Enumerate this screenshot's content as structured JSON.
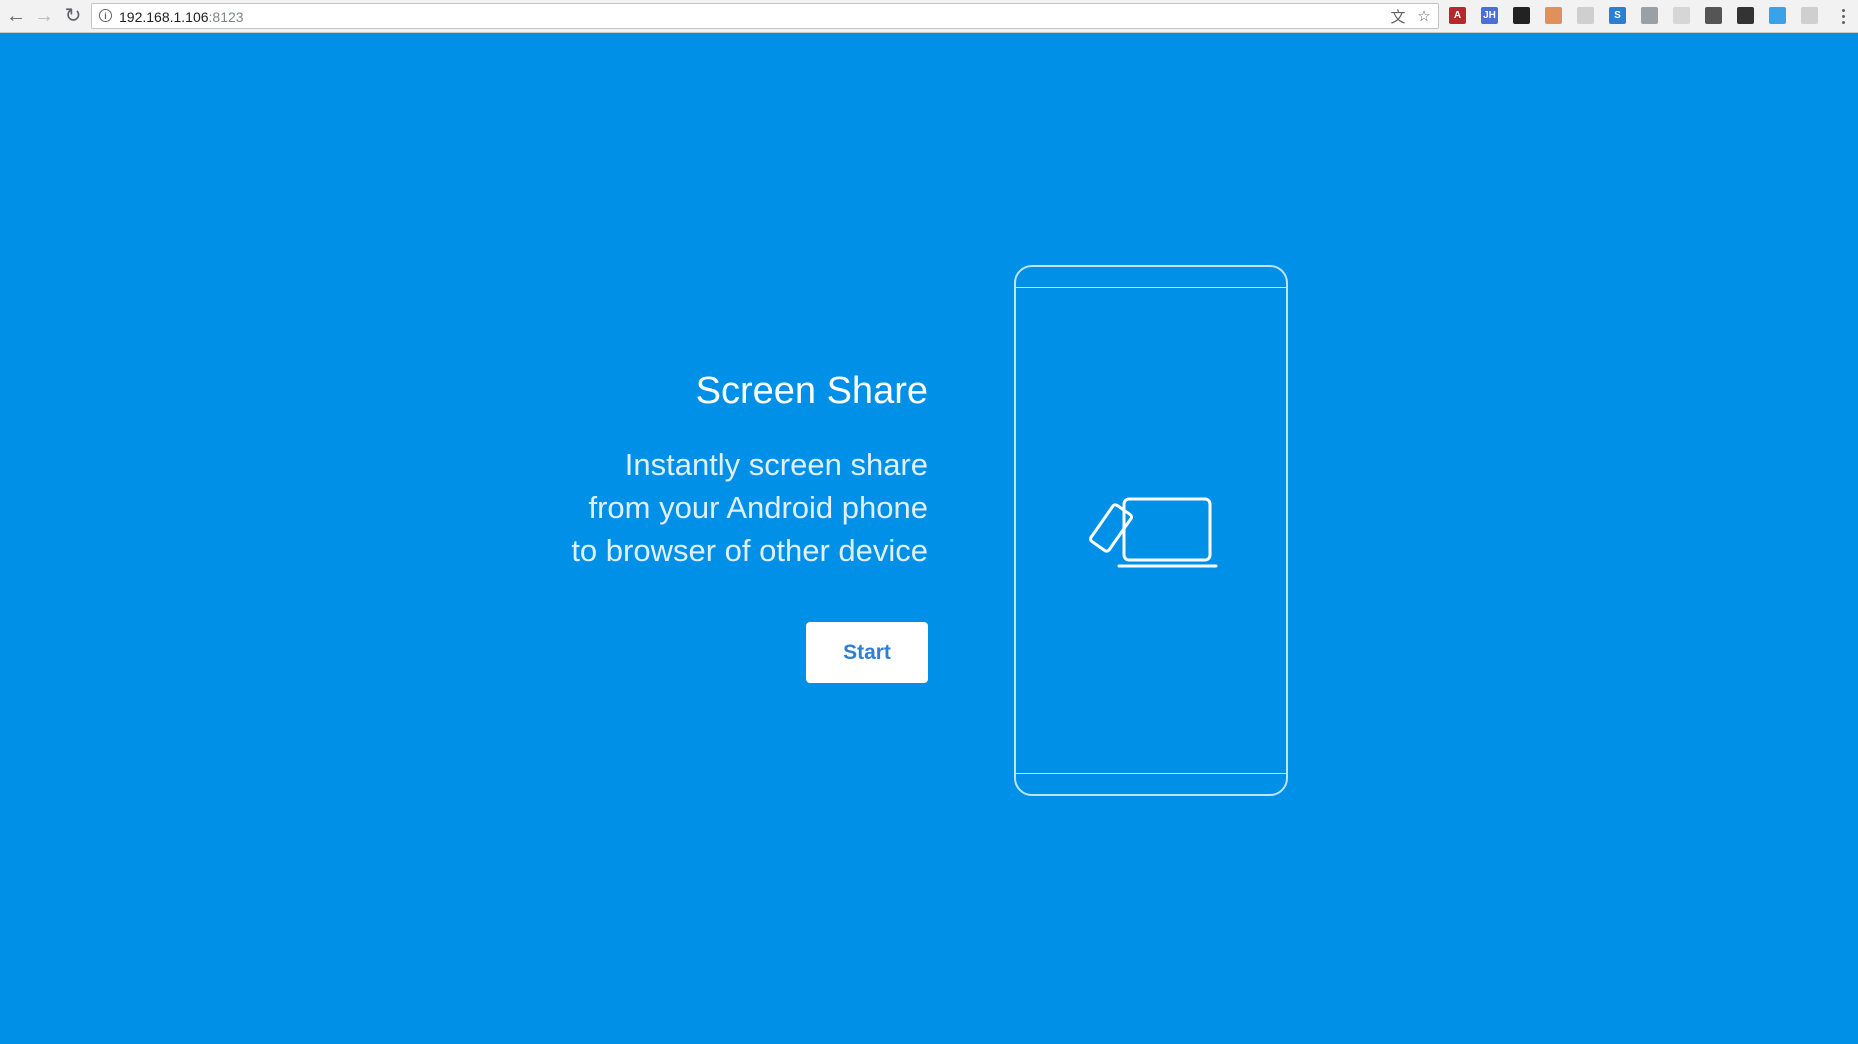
{
  "browser": {
    "url_host": "192.168.1.106",
    "url_port": ":8123",
    "nav_back_icon": "←",
    "nav_forward_icon": "→",
    "nav_reload_icon": "↻",
    "info_icon": "i",
    "translate_icon": "文",
    "bookmark_icon": "☆",
    "extensions": [
      {
        "name": "acrobat-ext-icon",
        "label": "A",
        "color": "#b7282e"
      },
      {
        "name": "jh-ext-icon",
        "label": "JH",
        "color": "#4a6fd8"
      },
      {
        "name": "incognito-ext-icon",
        "label": "",
        "color": "#222222"
      },
      {
        "name": "face-ext-icon",
        "label": "",
        "color": "#e0905a"
      },
      {
        "name": "extension-5-icon",
        "label": "",
        "color": "#cfcfcf"
      },
      {
        "name": "s-ext-icon",
        "label": "S",
        "color": "#2a7fd4"
      },
      {
        "name": "shield-ext-icon",
        "label": "",
        "color": "#9aa0a6"
      },
      {
        "name": "extension-8-icon",
        "label": "",
        "color": "#d6d6d6"
      },
      {
        "name": "sync-ext-icon",
        "label": "",
        "color": "#555555"
      },
      {
        "name": "tab-ext-icon",
        "label": "",
        "color": "#333333"
      },
      {
        "name": "note-ext-icon",
        "label": "",
        "color": "#3aa2e8"
      },
      {
        "name": "chat-ext-icon",
        "label": "",
        "color": "#cfcfcf"
      }
    ]
  },
  "hero": {
    "title": "Screen Share",
    "subtitle_lines": [
      "Instantly screen share",
      "from your Android phone",
      "to browser of other device"
    ],
    "start_label": "Start"
  },
  "colors": {
    "background": "#0090e8",
    "button_text": "#2f7fd3"
  }
}
